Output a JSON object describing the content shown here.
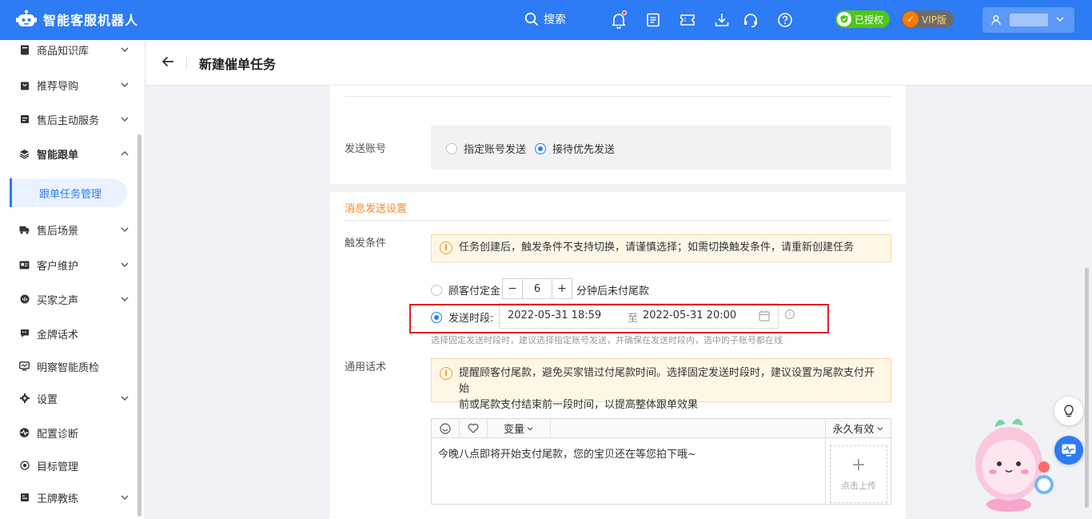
{
  "app": {
    "title": "智能客服机器人"
  },
  "topbar": {
    "search_label": "搜索",
    "icons": [
      "bell-icon",
      "list-icon",
      "ticket-icon",
      "download-icon",
      "headset-icon",
      "help-icon"
    ],
    "auth_badge": "已授权",
    "vip_badge": "VIP版",
    "colors": {
      "primary": "#2d7bf5",
      "auth": "#52c41a",
      "vip": "#ff7a00"
    }
  },
  "sidebar": {
    "items": [
      {
        "label": "商品知识库",
        "icon": "book-icon",
        "expanded": false
      },
      {
        "label": "推荐导购",
        "icon": "bag-icon",
        "expanded": false
      },
      {
        "label": "售后主动服务",
        "icon": "service-icon",
        "expanded": false
      },
      {
        "label": "智能跟单",
        "icon": "layers-icon",
        "expanded": true
      },
      {
        "label": "售后场景",
        "icon": "truck-icon",
        "expanded": false
      },
      {
        "label": "客户维护",
        "icon": "card-icon",
        "expanded": false
      },
      {
        "label": "买家之声",
        "icon": "voice-icon",
        "expanded": false
      },
      {
        "label": "金牌话术",
        "icon": "chat-icon",
        "expanded": null
      },
      {
        "label": "明察智能质检",
        "icon": "monitor-icon",
        "expanded": null
      },
      {
        "label": "设置",
        "icon": "gear-icon",
        "expanded": false
      },
      {
        "label": "配置诊断",
        "icon": "pulse-icon",
        "expanded": null
      },
      {
        "label": "目标管理",
        "icon": "target-icon",
        "expanded": null
      },
      {
        "label": "王牌教练",
        "icon": "coach-icon",
        "expanded": false
      }
    ],
    "active_sub": "跟单任务管理"
  },
  "page": {
    "title": "新建催单任务",
    "send_account": {
      "label": "发送账号",
      "options": [
        "指定账号发送",
        "接待优先发送"
      ],
      "selected": "接待优先发送"
    },
    "message_settings": {
      "section_title": "消息发送设置",
      "trigger_label": "触发条件",
      "trigger_alert": "任务创建后，触发条件不支持切换，请谨慎选择；如需切换触发条件，请重新创建任务",
      "option_deposit": "顾客付定金",
      "minutes_value": "6",
      "minus": "−",
      "plus": "+",
      "after_text": "分钟后未付尾款",
      "option_period": "发送时段:",
      "selected": "发送时段",
      "range_start": "2022-05-31 18:59",
      "range_to": "至",
      "range_end": "2022-05-31 20:00",
      "hint": "选择固定发送时段时，建议选择指定账号发送，并确保在发送时段内，选中的子账号都在线",
      "script_label": "通用话术",
      "script_alert_line1": "提醒顾客付尾款，避免买家错过付尾款时间。选择固定发送时段时，建议设置为尾款支付开始",
      "script_alert_line2": "前或尾款支付结束前一段时间，以提高整体跟单效果",
      "editor": {
        "variable_label": "变量",
        "validity_label": "永久有效",
        "content": "今晚八点即将开始支付尾款，您的宝贝还在等您拍下哦~",
        "upload_label": "点击上传"
      }
    }
  }
}
